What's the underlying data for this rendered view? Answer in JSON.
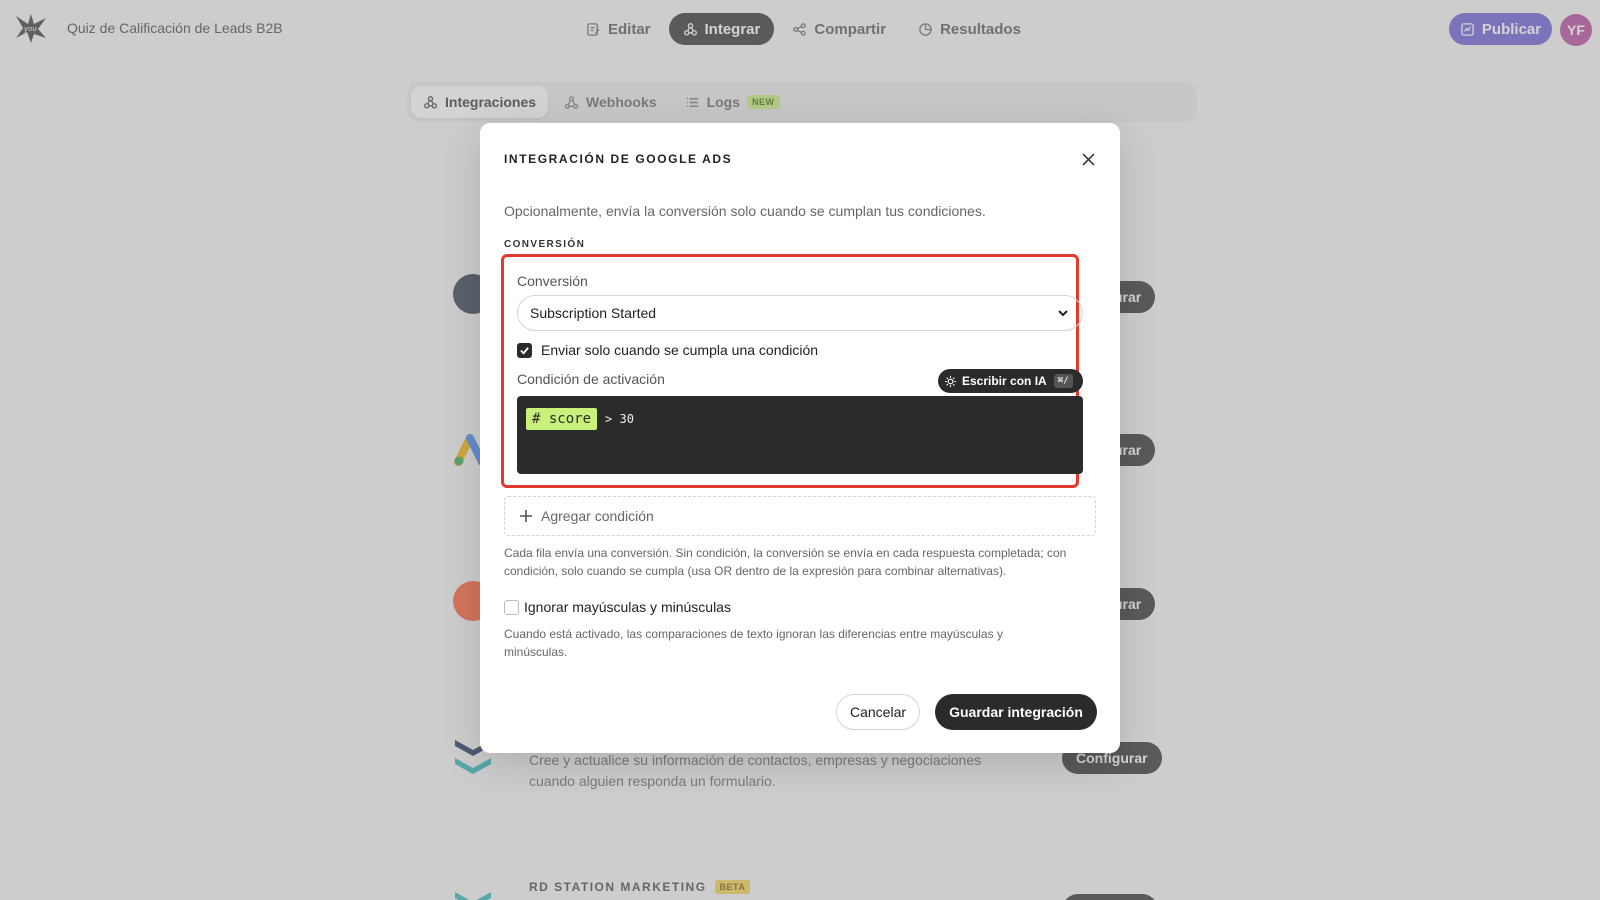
{
  "app": {
    "title": "Quiz de Calificación de Leads B2B",
    "avatar_initials": "YF"
  },
  "nav": {
    "tabs": [
      {
        "label": "Editar",
        "icon": "edit-icon",
        "active": false
      },
      {
        "label": "Integrar",
        "icon": "integrate-icon",
        "active": true
      },
      {
        "label": "Compartir",
        "icon": "share-icon",
        "active": false
      },
      {
        "label": "Resultados",
        "icon": "results-icon",
        "active": false
      }
    ],
    "publish_label": "Publicar"
  },
  "subtabs": [
    {
      "label": "Integraciones",
      "icon": "integrations-icon",
      "active": true
    },
    {
      "label": "Webhooks",
      "icon": "webhooks-icon",
      "active": false
    },
    {
      "label": "Logs",
      "icon": "list-icon",
      "active": false,
      "badge": "NEW"
    }
  ],
  "background": {
    "configure_partial": "urar",
    "configure_label": "Configurar",
    "item_description": "Cree y actualice su información de contactos, empresas y negociaciones cuando alguien responda un formulario.",
    "next_title": "RD STATION MARKETING",
    "next_badge": "BETA"
  },
  "modal": {
    "title": "INTEGRACIÓN DE GOOGLE ADS",
    "description": "Opcionalmente, envía la conversión solo cuando se cumplan tus condiciones.",
    "section_label": "CONVERSIÓN",
    "conversion_label": "Conversión",
    "conversion_value": "Subscription Started",
    "only_when_label": "Enviar solo cuando se cumpla una condición",
    "only_when_checked": true,
    "trigger_label": "Condición de activación",
    "ai_button_label": "Escribir con IA",
    "ai_shortcut": "⌘/",
    "code": {
      "var_symbol": "#",
      "var_name": "score",
      "expression": "> 30"
    },
    "add_condition_label": "Agregar condición",
    "help_rows": "Cada fila envía una conversión. Sin condición, la conversión se envía en cada respuesta completada; con condición, solo cuando se cumpla (usa OR dentro de la expresión para combinar alternativas).",
    "ignore_case_label": "Ignorar mayúsculas y minúsculas",
    "ignore_case_checked": false,
    "help_ignore_case": "Cuando está activado, las comparaciones de texto ignoran las diferencias entre mayúsculas y minúsculas.",
    "cancel_label": "Cancelar",
    "save_label": "Guardar integración"
  },
  "colors": {
    "accent_dark": "#2b2b2b",
    "publish": "#6a5cd6",
    "highlight": "#e23b2e",
    "variable_chip": "#c9f07a",
    "avatar": "#b6459e"
  }
}
